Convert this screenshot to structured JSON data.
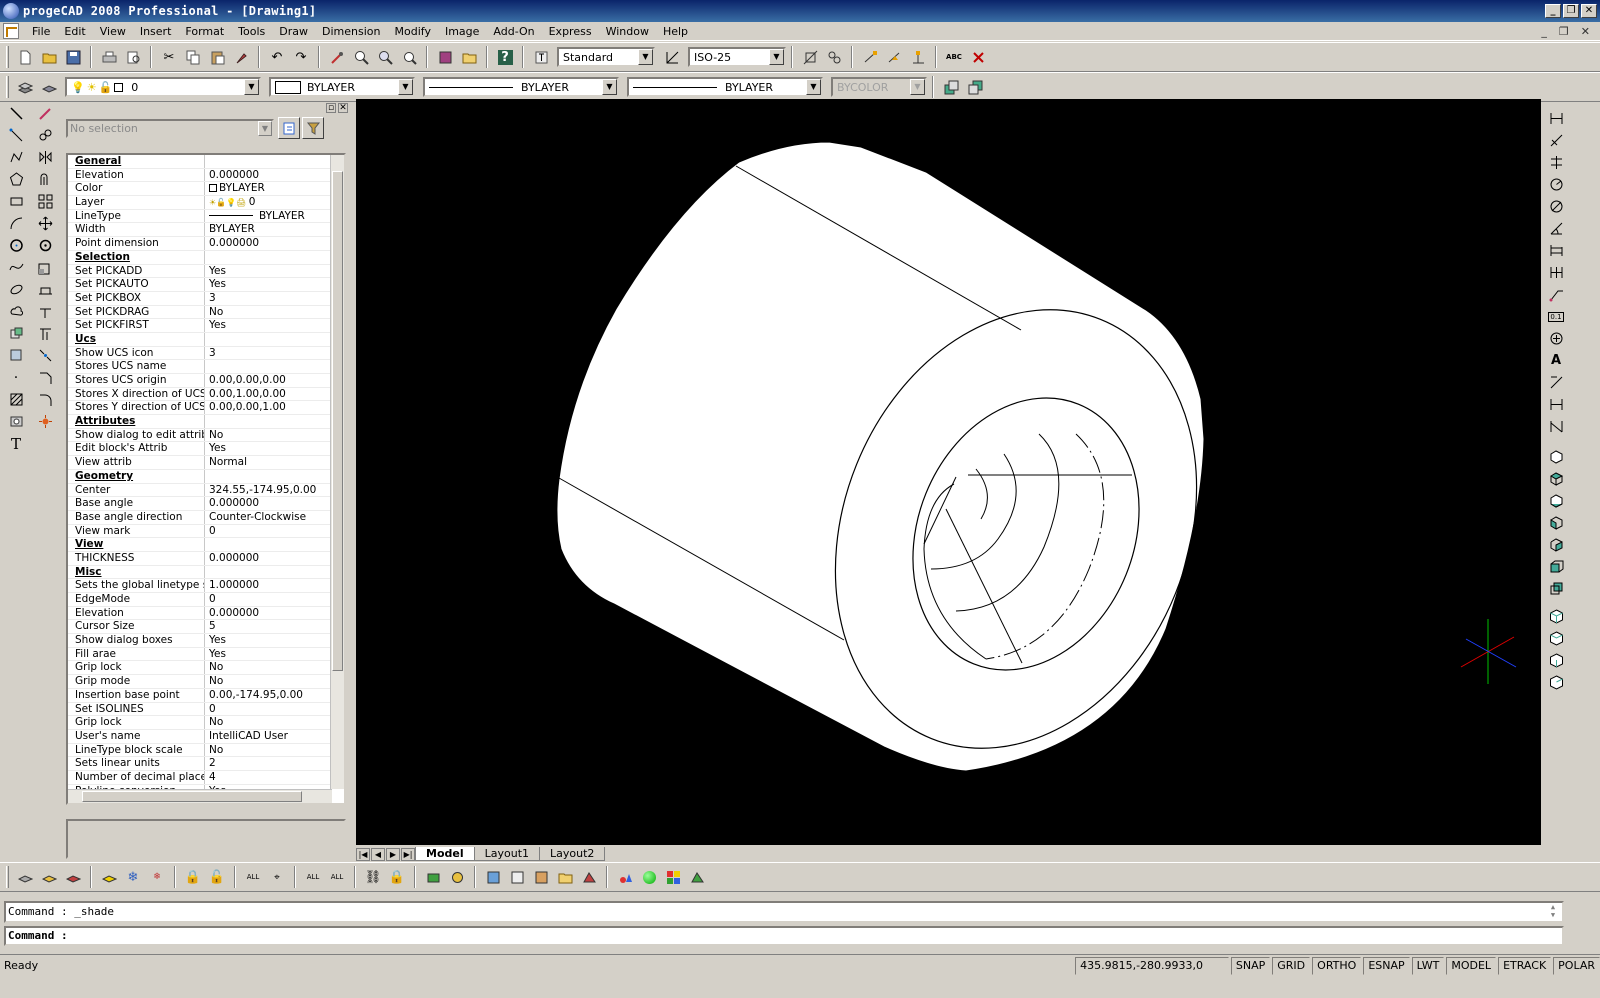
{
  "window": {
    "title": "progeCAD 2008 Professional - [Drawing1]",
    "minimize": "_",
    "restore": "❐",
    "close": "✕",
    "mdi_minimize": "_",
    "mdi_restore": "❐",
    "mdi_close": "✕"
  },
  "menu": [
    "File",
    "Edit",
    "View",
    "Insert",
    "Format",
    "Tools",
    "Draw",
    "Dimension",
    "Modify",
    "Image",
    "Add-On",
    "Express",
    "Window",
    "Help"
  ],
  "toolbar1": {
    "text_style": "Standard",
    "dim_style": "ISO-25"
  },
  "toolbar2": {
    "layer": "0",
    "color": "BYLAYER",
    "linetype": "BYLAYER",
    "lineweight": "BYLAYER",
    "plotstyle": "BYCOLOR"
  },
  "properties": {
    "selection": "No selection",
    "rows": [
      {
        "name": "General",
        "value": "",
        "cat": true
      },
      {
        "name": "Elevation",
        "value": "0.000000"
      },
      {
        "name": "Color",
        "value": "BYLAYER"
      },
      {
        "name": "Layer",
        "value": "0"
      },
      {
        "name": "LineType",
        "value": "BYLAYER"
      },
      {
        "name": "Width",
        "value": "BYLAYER"
      },
      {
        "name": "Point dimension",
        "value": "0.000000"
      },
      {
        "name": "Selection",
        "value": "",
        "cat": true
      },
      {
        "name": "Set PICKADD",
        "value": "Yes"
      },
      {
        "name": "Set PICKAUTO",
        "value": "Yes"
      },
      {
        "name": "Set PICKBOX",
        "value": "3"
      },
      {
        "name": "Set PICKDRAG",
        "value": "No"
      },
      {
        "name": "Set PICKFIRST",
        "value": "Yes"
      },
      {
        "name": "Ucs",
        "value": "",
        "cat": true
      },
      {
        "name": "Show UCS icon",
        "value": "3"
      },
      {
        "name": "Stores UCS name",
        "value": ""
      },
      {
        "name": "Stores UCS origin",
        "value": "0.00,0.00,0.00"
      },
      {
        "name": "Stores X direction of UCS",
        "value": "0.00,1.00,0.00"
      },
      {
        "name": "Stores Y direction of UCS",
        "value": "0.00,0.00,1.00"
      },
      {
        "name": "Attributes",
        "value": "",
        "cat": true
      },
      {
        "name": "Show dialog to edit attrib",
        "value": "No"
      },
      {
        "name": "Edit block's Attrib",
        "value": "Yes"
      },
      {
        "name": "View attrib",
        "value": "Normal"
      },
      {
        "name": "Geometry",
        "value": "",
        "cat": true
      },
      {
        "name": "Center",
        "value": "324.55,-174.95,0.00"
      },
      {
        "name": "Base angle",
        "value": "0.000000"
      },
      {
        "name": "Base angle direction",
        "value": "Counter-Clockwise"
      },
      {
        "name": "View mark",
        "value": "0"
      },
      {
        "name": "View",
        "value": "",
        "cat": true
      },
      {
        "name": "THICKNESS",
        "value": "0.000000"
      },
      {
        "name": "Misc",
        "value": "",
        "cat": true
      },
      {
        "name": "Sets the global linetype sc...",
        "value": "1.000000"
      },
      {
        "name": "EdgeMode",
        "value": "0"
      },
      {
        "name": "Elevation",
        "value": "0.000000"
      },
      {
        "name": "Cursor Size",
        "value": "5"
      },
      {
        "name": "Show dialog boxes",
        "value": "Yes"
      },
      {
        "name": "Fill arae",
        "value": "Yes"
      },
      {
        "name": "Grip lock",
        "value": "No"
      },
      {
        "name": "Grip mode",
        "value": "No"
      },
      {
        "name": "Insertion base point",
        "value": "0.00,-174.95,0.00"
      },
      {
        "name": "Set ISOLINES",
        "value": "0"
      },
      {
        "name": "Grip lock",
        "value": "No"
      },
      {
        "name": "User's name",
        "value": "IntelliCAD User"
      },
      {
        "name": "LineType block scale",
        "value": "No"
      },
      {
        "name": "Sets linear units",
        "value": "2"
      },
      {
        "name": "Number of decimal places",
        "value": "4"
      },
      {
        "name": "Polyline conversion",
        "value": "Yes"
      }
    ]
  },
  "layout_tabs": [
    "Model",
    "Layout1",
    "Layout2"
  ],
  "command": {
    "history": "Command : _shade",
    "prompt": "Command :"
  },
  "status": {
    "ready": "Ready",
    "coords": "435.9815,-280.9933,0",
    "toggles": [
      "SNAP",
      "GRID",
      "ORTHO",
      "ESNAP",
      "LWT",
      "MODEL",
      "ETRACK",
      "POLAR"
    ]
  }
}
